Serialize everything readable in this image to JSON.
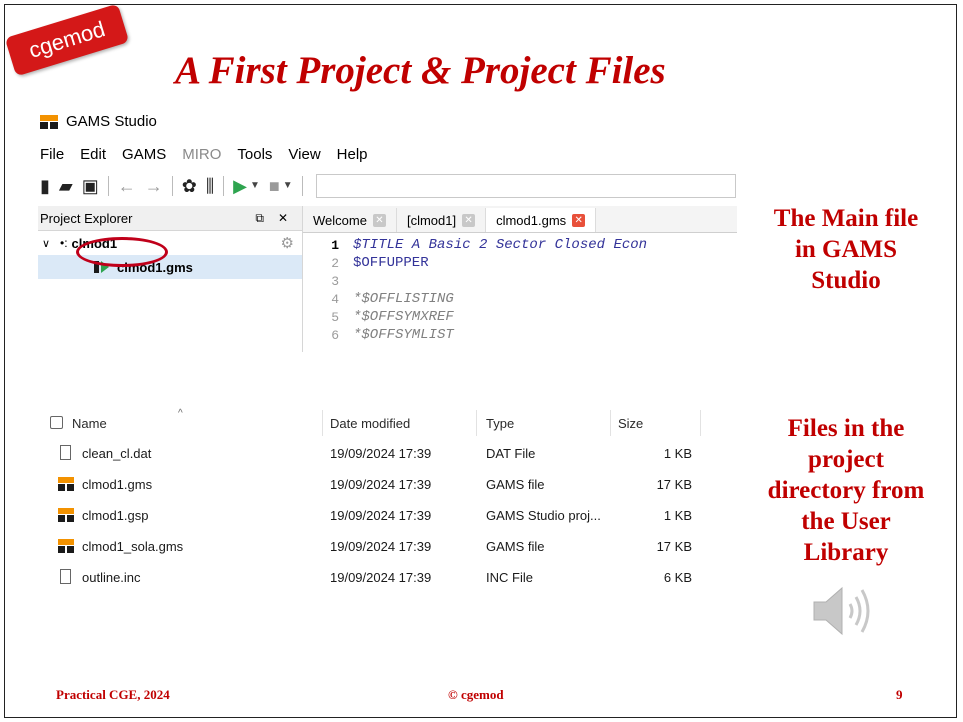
{
  "badge": "cgemod",
  "slide_title": "A First Project & Project Files",
  "app": {
    "title": "GAMS Studio",
    "menu": [
      "File",
      "Edit",
      "GAMS",
      "MIRO",
      "Tools",
      "View",
      "Help"
    ]
  },
  "explorer": {
    "title": "Project Explorer",
    "project": "clmod1",
    "file": "clmod1.gms"
  },
  "editor": {
    "tabs": [
      "Welcome",
      "[clmod1]",
      "clmod1.gms"
    ],
    "lines": [
      {
        "n": "1",
        "text": "$TITLE A Basic 2 Sector Closed Econ"
      },
      {
        "n": "2",
        "text": "$OFFUPPER"
      },
      {
        "n": "3",
        "text": ""
      },
      {
        "n": "4",
        "text": "*$OFFLISTING"
      },
      {
        "n": "5",
        "text": "*$OFFSYMXREF"
      },
      {
        "n": "6",
        "text": "*$OFFSYMLIST"
      }
    ]
  },
  "file_list": {
    "headers": {
      "name": "Name",
      "date": "Date modified",
      "type": "Type",
      "size": "Size"
    },
    "rows": [
      {
        "name": "clean_cl.dat",
        "date": "19/09/2024 17:39",
        "type": "DAT File",
        "size": "1 KB",
        "icon": "document-icon"
      },
      {
        "name": "clmod1.gms",
        "date": "19/09/2024 17:39",
        "type": "GAMS file",
        "size": "17 KB",
        "icon": "gams-file-icon"
      },
      {
        "name": "clmod1.gsp",
        "date": "19/09/2024 17:39",
        "type": "GAMS Studio proj...",
        "size": "1 KB",
        "icon": "gams-file-icon"
      },
      {
        "name": "clmod1_sola.gms",
        "date": "19/09/2024 17:39",
        "type": "GAMS file",
        "size": "17 KB",
        "icon": "gams-file-icon"
      },
      {
        "name": "outline.inc",
        "date": "19/09/2024 17:39",
        "type": "INC File",
        "size": "6 KB",
        "icon": "document-icon"
      }
    ]
  },
  "side_notes": {
    "top": [
      "The Main file",
      "in GAMS",
      "Studio"
    ],
    "bottom": [
      "Files in the",
      "project",
      "directory from",
      "the User",
      "Library"
    ]
  },
  "footer": {
    "left": "Practical CGE, 2024",
    "center": "© cgemod",
    "right": "9"
  },
  "colors": {
    "accent": "#c00000",
    "gams_orange": "#f39200",
    "run_green": "#2ea44f",
    "tab_close": "#e8503a"
  }
}
